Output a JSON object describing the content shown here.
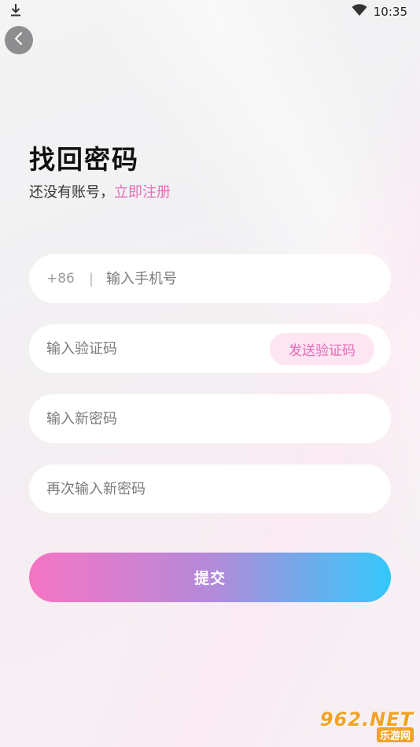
{
  "status_bar": {
    "time": "10:35",
    "download_icon": "download-icon",
    "wifi_icon": "wifi-icon"
  },
  "header": {
    "back_icon": "chevron-left-icon",
    "title": "找回密码",
    "subtitle_text": "还没有账号，",
    "register_link": "立即注册"
  },
  "form": {
    "phone": {
      "prefix": "+86",
      "divider": "|",
      "placeholder": "输入手机号",
      "value": ""
    },
    "code": {
      "placeholder": "输入验证码",
      "value": "",
      "send_label": "发送验证码"
    },
    "new_password": {
      "placeholder": "输入新密码",
      "value": ""
    },
    "confirm_password": {
      "placeholder": "再次输入新密码",
      "value": ""
    },
    "submit_label": "提交"
  },
  "watermark": {
    "top": "962.NET",
    "bottom": "乐游网"
  },
  "colors": {
    "accent_pink": "#e66bb7",
    "send_code_bg": "#fde5f2",
    "gradient_start": "#f674c4",
    "gradient_end": "#33c8fb"
  }
}
